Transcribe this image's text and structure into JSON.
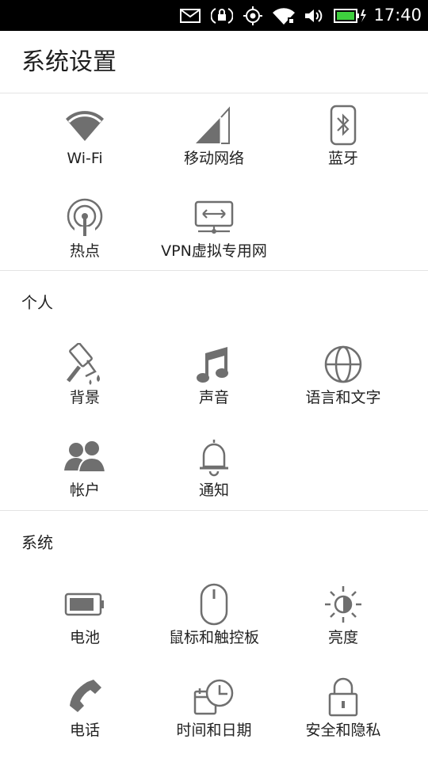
{
  "status_bar": {
    "time": "17:40",
    "icons": [
      "mail-icon",
      "alarm-icon",
      "location-icon",
      "wifi-icon",
      "volume-icon",
      "battery-charging-icon"
    ],
    "battery_color": "#3ecf3e"
  },
  "header": {
    "title": "系统设置"
  },
  "network": {
    "items": [
      {
        "label": "Wi-Fi",
        "icon": "wifi-icon"
      },
      {
        "label": "移动网络",
        "icon": "cellular-signal-icon"
      },
      {
        "label": "蓝牙",
        "icon": "bluetooth-icon"
      },
      {
        "label": "热点",
        "icon": "hotspot-icon"
      },
      {
        "label": "VPN虚拟专用网",
        "icon": "vpn-icon"
      }
    ]
  },
  "personal": {
    "label": "个人",
    "items": [
      {
        "label": "背景",
        "icon": "paint-roller-icon"
      },
      {
        "label": "声音",
        "icon": "music-note-icon"
      },
      {
        "label": "语言和文字",
        "icon": "globe-icon"
      },
      {
        "label": "帐户",
        "icon": "accounts-icon"
      },
      {
        "label": "通知",
        "icon": "bell-icon"
      }
    ]
  },
  "system": {
    "label": "系统",
    "items": [
      {
        "label": "电池",
        "icon": "battery-icon"
      },
      {
        "label": "鼠标和触控板",
        "icon": "mouse-icon"
      },
      {
        "label": "亮度",
        "icon": "brightness-icon"
      },
      {
        "label": "电话",
        "icon": "phone-icon"
      },
      {
        "label": "时间和日期",
        "icon": "clock-calendar-icon"
      },
      {
        "label": "安全和隐私",
        "icon": "lock-icon"
      }
    ]
  },
  "colors": {
    "icon_gray": "#6f6f6f",
    "divider": "#e4e4e4"
  }
}
